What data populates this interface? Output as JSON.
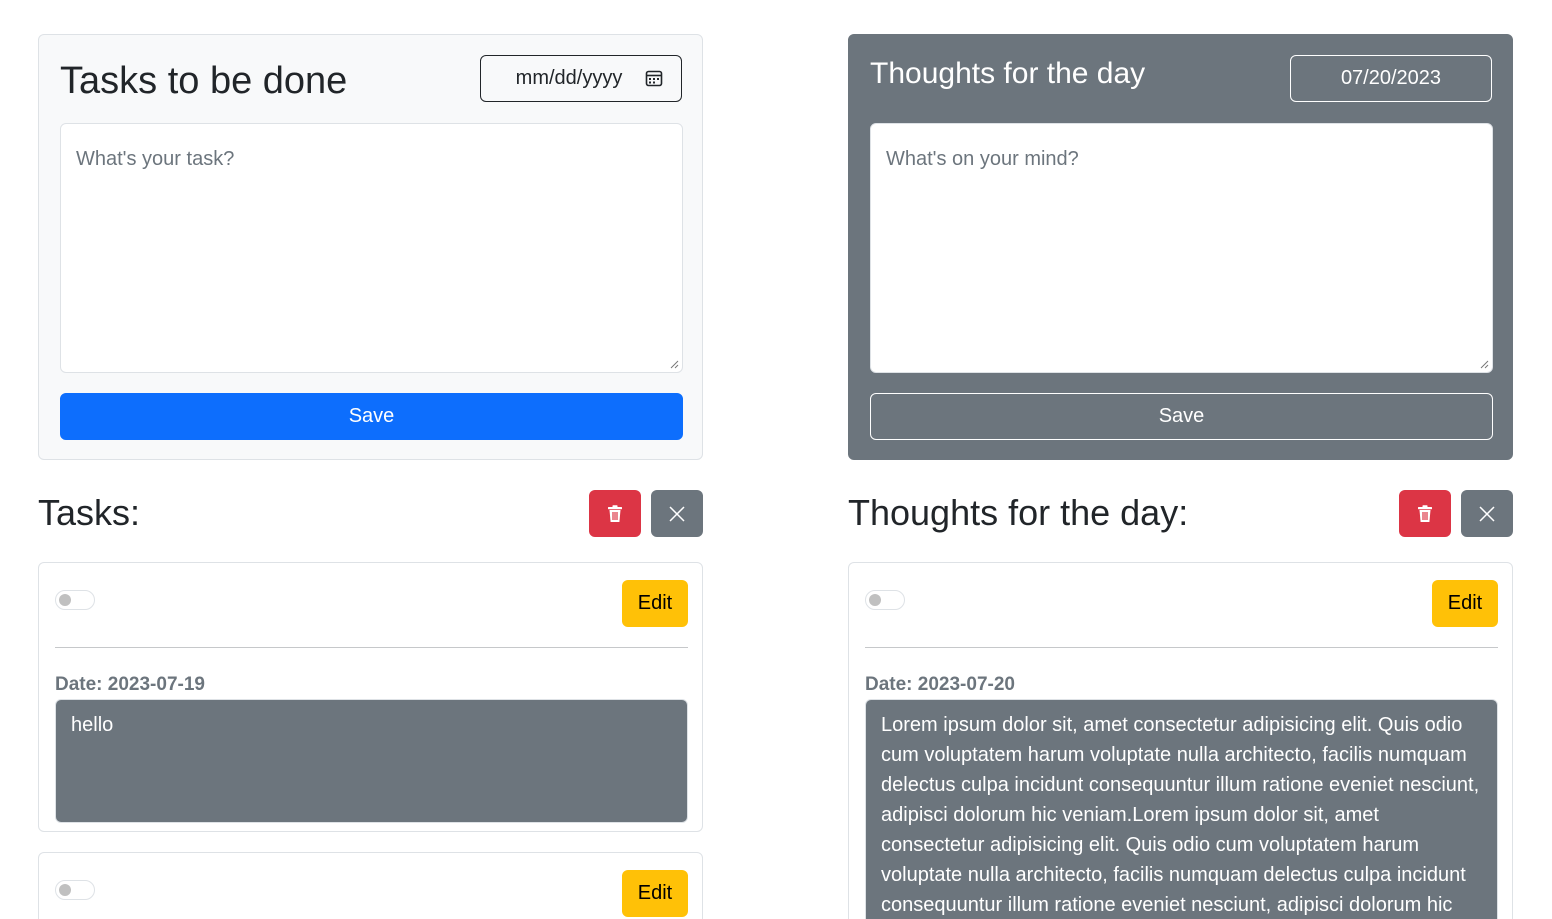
{
  "tasks_form": {
    "title": "Tasks to be done",
    "date_placeholder": "mm/dd/yyyy",
    "textarea_placeholder": "What's your task?",
    "save_label": "Save"
  },
  "thoughts_form": {
    "title": "Thoughts for the day",
    "date_value": "07/20/2023",
    "textarea_placeholder": "What's on your mind?",
    "save_label": "Save"
  },
  "tasks_list": {
    "heading": "Tasks:",
    "items": [
      {
        "edit_label": "Edit",
        "date_label": "Date: 2023-07-19",
        "content": "hello"
      },
      {
        "edit_label": "Edit"
      }
    ]
  },
  "thoughts_list": {
    "heading": "Thoughts for the day:",
    "items": [
      {
        "edit_label": "Edit",
        "date_label": "Date: 2023-07-20",
        "content": "Lorem ipsum dolor sit, amet consectetur adipisicing elit. Quis odio cum voluptatem harum voluptate nulla architecto, facilis numquam delectus culpa incidunt consequuntur illum ratione eveniet nesciunt, adipisci dolorum hic veniam.Lorem ipsum dolor sit, amet consectetur adipisicing elit. Quis odio cum voluptatem harum voluptate nulla architecto, facilis numquam delectus culpa incidunt consequuntur illum ratione eveniet nesciunt, adipisci dolorum hic"
      }
    ]
  },
  "icons": {
    "delete": "trash-icon",
    "clear": "close-icon",
    "calendar": "calendar-icon"
  },
  "colors": {
    "primary": "#0d6efd",
    "danger": "#dc3545",
    "secondary": "#6c757d",
    "warning": "#ffc107"
  }
}
